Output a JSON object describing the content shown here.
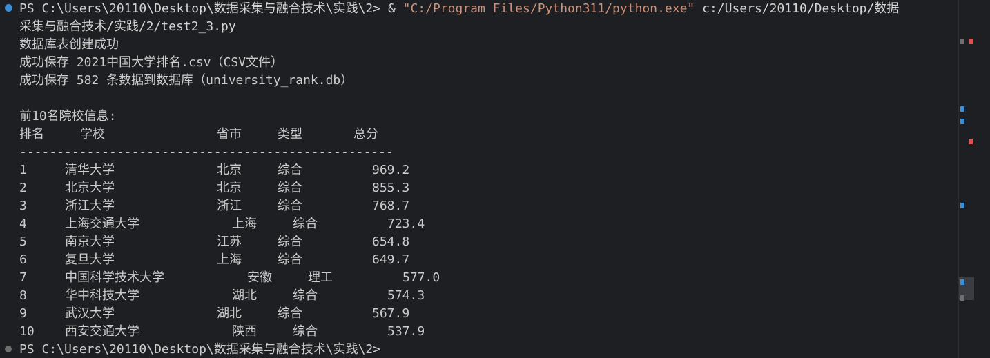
{
  "terminal": {
    "prompt_prefix": "PS C:\\Users\\20110\\Desktop\\数据采集与融合技术\\实践\\2>",
    "command_op": " & ",
    "command_exe": "\"C:/Program Files/Python311/python.exe\"",
    "command_arg_1": " c:/Users/20110/Desktop/数据",
    "command_arg_2": "采集与融合技术/实践/2/test2_3.py",
    "output": {
      "msg_table_created": "数据库表创建成功",
      "msg_csv_saved": "成功保存 2021中国大学排名.csv（CSV文件）",
      "msg_db_saved": "成功保存 582 条数据到数据库（university_rank.db）",
      "top_title": "前10名院校信息:",
      "headers": {
        "rank": "排名",
        "school": "学校",
        "province": "省市",
        "type": "类型",
        "score": "总分"
      },
      "separator": "--------------------------------------------------",
      "rows": [
        {
          "rank": "1",
          "school": "清华大学",
          "province": "北京",
          "type": "综合",
          "score": "969.2"
        },
        {
          "rank": "2",
          "school": "北京大学",
          "province": "北京",
          "type": "综合",
          "score": "855.3"
        },
        {
          "rank": "3",
          "school": "浙江大学",
          "province": "浙江",
          "type": "综合",
          "score": "768.7"
        },
        {
          "rank": "4",
          "school": "上海交通大学",
          "province": "上海",
          "type": "综合",
          "score": "723.4"
        },
        {
          "rank": "5",
          "school": "南京大学",
          "province": "江苏",
          "type": "综合",
          "score": "654.8"
        },
        {
          "rank": "6",
          "school": "复旦大学",
          "province": "上海",
          "type": "综合",
          "score": "649.7"
        },
        {
          "rank": "7",
          "school": "中国科学技术大学",
          "province": "安徽",
          "type": "理工",
          "score": "577.0"
        },
        {
          "rank": "8",
          "school": "华中科技大学",
          "province": "湖北",
          "type": "综合",
          "score": "574.3"
        },
        {
          "rank": "9",
          "school": "武汉大学",
          "province": "湖北",
          "type": "综合",
          "score": "567.9"
        },
        {
          "rank": "10",
          "school": "西安交通大学",
          "province": "陕西",
          "type": "综合",
          "score": "537.9"
        }
      ]
    },
    "final_prompt": "PS C:\\Users\\20110\\Desktop\\数据采集与融合技术\\实践\\2>"
  },
  "colors": {
    "background": "#1e1f22",
    "text": "#cccccc",
    "string": "#ce9178",
    "decoration_blue": "#3a8fd6",
    "marker_red": "#e05252"
  }
}
